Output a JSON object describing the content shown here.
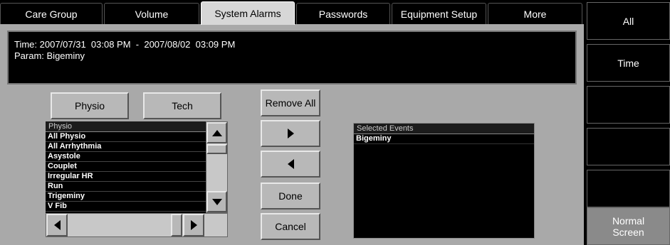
{
  "tabs": [
    "Care Group",
    "Volume",
    "System Alarms",
    "Passwords",
    "Equipment Setup",
    "More"
  ],
  "info": {
    "time_line": "Time: 2007/07/31  03:08 PM  -  2007/08/02  03:09 PM",
    "param_line": "Param: Bigeminy"
  },
  "category_buttons": {
    "physio": "Physio",
    "tech": "Tech"
  },
  "event_list": {
    "header": "Physio",
    "items": [
      "All Physio",
      "All Arrhythmia",
      "Asystole",
      "Couplet",
      "Irregular HR",
      "Run",
      "Trigeminy",
      "V Fib"
    ]
  },
  "actions": {
    "remove_all": "Remove All",
    "done": "Done",
    "cancel": "Cancel"
  },
  "selected_events": {
    "header": "Selected Events",
    "items": [
      "Bigeminy"
    ]
  },
  "side_buttons": {
    "all": "All",
    "time": "Time",
    "normal_screen_1": "Normal",
    "normal_screen_2": "Screen"
  },
  "icons": {
    "add": "arrow-right-icon",
    "remove": "arrow-left-icon"
  }
}
